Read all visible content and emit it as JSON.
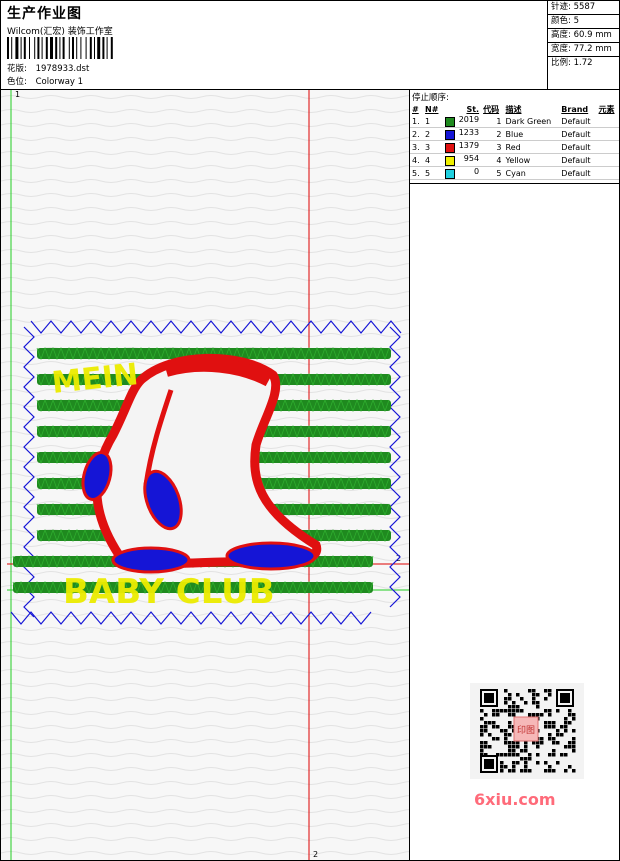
{
  "header": {
    "title": "生产作业图",
    "company": "Wilcom(汇宏) 装饰工作室",
    "pattern_label": "花版:",
    "pattern_value": "1978933.dst",
    "colorway_label": "色位:",
    "colorway_value": "Colorway 1"
  },
  "stats": [
    {
      "label": "针迹:",
      "value": "5587"
    },
    {
      "label": "颜色:",
      "value": "5"
    },
    {
      "label": "高度:",
      "value": "60.9 mm"
    },
    {
      "label": "宽度:",
      "value": "77.2 mm"
    },
    {
      "label": "比例:",
      "value": "1.72"
    }
  ],
  "stop_sequence": {
    "title": "停止顺序:",
    "columns": [
      "#",
      "N#",
      "St.",
      "代码",
      "描述",
      "Brand",
      "元素"
    ],
    "rows": [
      {
        "idx": "1.",
        "n": "1",
        "color": "#1f8a1f",
        "st": "2019",
        "code": "1",
        "desc": "Dark Green",
        "brand": "Default"
      },
      {
        "idx": "2.",
        "n": "2",
        "color": "#1515d6",
        "st": "1233",
        "code": "2",
        "desc": "Blue",
        "brand": "Default"
      },
      {
        "idx": "3.",
        "n": "3",
        "color": "#e01010",
        "st": "1379",
        "code": "3",
        "desc": "Red",
        "brand": "Default"
      },
      {
        "idx": "4.",
        "n": "4",
        "color": "#f0f000",
        "st": "954",
        "code": "4",
        "desc": "Yellow",
        "brand": "Default"
      },
      {
        "idx": "5.",
        "n": "5",
        "color": "#20d0e0",
        "st": "0",
        "code": "5",
        "desc": "Cyan",
        "brand": "Default"
      }
    ]
  },
  "design": {
    "marker_top": "1",
    "marker_right": "2",
    "marker_bottom": "2",
    "text_top": "MEIN",
    "text_bottom": "BABY CLUB"
  },
  "watermark": {
    "brand": "6xiu.com",
    "seal": "印图"
  }
}
